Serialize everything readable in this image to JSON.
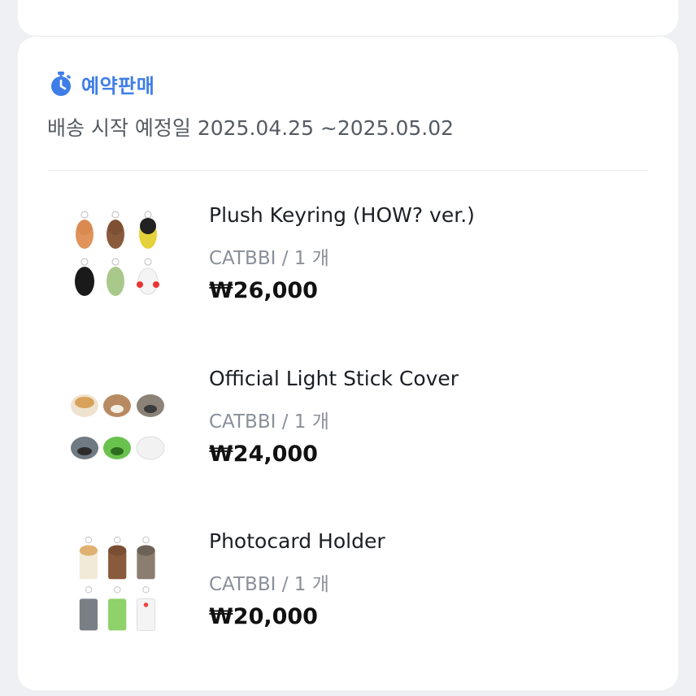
{
  "preorder": {
    "badge_icon": "stopwatch-icon",
    "label": "예약판매",
    "accent": "#3f7ee8",
    "shipping_text": "배송 시작 예정일 2025.04.25 ~2025.05.02"
  },
  "items": [
    {
      "name": "Plush Keyring (HOW? ver.)",
      "seller": "CATBBI / 1 개",
      "price": "₩26,000",
      "thumb_icon": "plush-keyring-thumbnail"
    },
    {
      "name": "Official Light Stick Cover",
      "seller": "CATBBI / 1 개",
      "price": "₩24,000",
      "thumb_icon": "light-stick-cover-thumbnail"
    },
    {
      "name": "Photocard Holder",
      "seller": "CATBBI / 1 개",
      "price": "₩20,000",
      "thumb_icon": "photocard-holder-thumbnail"
    }
  ]
}
